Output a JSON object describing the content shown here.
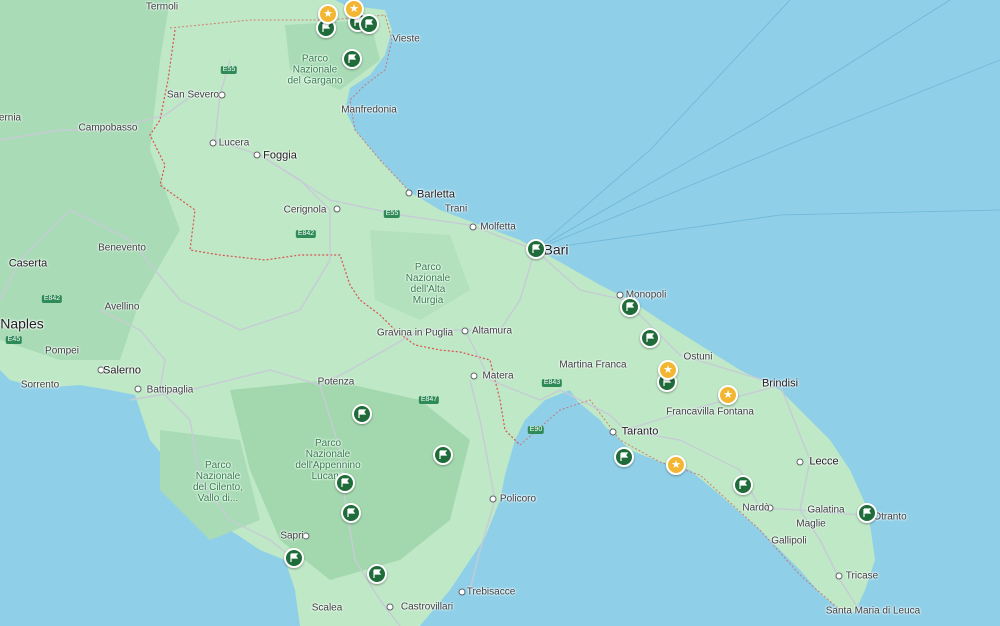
{
  "map": {
    "colors": {
      "sea": "#8fd0e8",
      "land": "#bfe8c6",
      "mountains": "#a7dcb3",
      "region_border": "#d9534f",
      "roads": "#c6cbd6",
      "pin": "#1f6b3a",
      "star": "#f2b632"
    },
    "labels": {
      "termoli": "Termoli",
      "vieste": "Vieste",
      "park_gargano": "Parco\nNazionale\ndel Gargano",
      "san_severo": "San Severo",
      "manfredonia": "Manfredonia",
      "ernia": "ernia",
      "campobasso": "Campobasso",
      "lucera": "Lucera",
      "foggia": "Foggia",
      "barletta": "Barletta",
      "trani": "Trani",
      "cerignola": "Cerignola",
      "molfetta": "Molfetta",
      "bari": "Bari",
      "benevento": "Benevento",
      "caserta": "Caserta",
      "park_alta_murgia": "Parco\nNazionale\ndell'Alta\nMurgia",
      "monopoli": "Monopoli",
      "avellino": "Avellino",
      "naples": "Naples",
      "gravina": "Gravina\nin Puglia",
      "altamura": "Altamura",
      "pompei": "Pompei",
      "ostuni": "Ostuni",
      "martina_franca": "Martina Franca",
      "salerno": "Salerno",
      "sorrento": "Sorrento",
      "battipaglia": "Battipaglia",
      "potenza": "Potenza",
      "matera": "Matera",
      "brindisi": "Brindisi",
      "francavilla": "Francavilla\nFontana",
      "taranto": "Taranto",
      "lecce": "Lecce",
      "park_appennino": "Parco\nNazionale\ndell'Appennino\nLucano",
      "park_cilento": "Parco\nNazionale\ndel Cilento,\nVallo di...",
      "policoro": "Policoro",
      "nardo": "Nardò",
      "galatina": "Galatina",
      "otranto": "Otranto",
      "maglie": "Maglie",
      "gallipoli": "Gallipoli",
      "sapri": "Sapri",
      "tricase": "Tricase",
      "trebisacce": "Trebisacce",
      "scalea": "Scalea",
      "castrovillari": "Castrovillari",
      "santa_maria": "Santa Maria\ndi Leuca"
    },
    "roads": {
      "e55a": "E55",
      "e55b": "E55",
      "e842a": "E842",
      "e842b": "E842",
      "e45": "E45",
      "e847": "E847",
      "e843": "E843",
      "e90": "E90"
    }
  }
}
